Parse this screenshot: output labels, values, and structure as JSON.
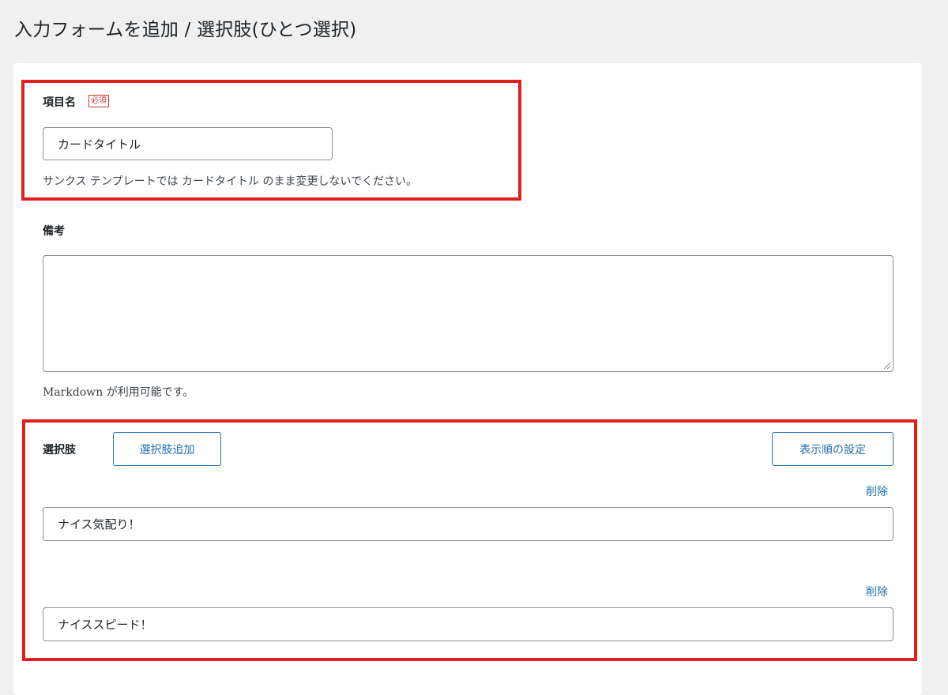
{
  "page": {
    "title": "入力フォームを追加 / 選択肢(ひとつ選択)"
  },
  "item_name": {
    "label": "項目名",
    "required_badge": "必須",
    "value": "カードタイトル",
    "help": "サンクス テンプレートでは カードタイトル のまま変更しないでください。"
  },
  "notes": {
    "label": "備考",
    "value": "",
    "help": "Markdown が利用可能です。"
  },
  "choices": {
    "label": "選択肢",
    "add_button": "選択肢追加",
    "order_button": "表示順の設定",
    "items": [
      {
        "delete_label": "削除",
        "value": "ナイス気配り！"
      },
      {
        "delete_label": "削除",
        "value": "ナイススピード！"
      }
    ]
  },
  "colors": {
    "highlight": "#e21f1f",
    "accent": "#2271b1",
    "required": "#d63638",
    "background": "#f0f0f1"
  },
  "icons": {
    "textarea_resize": "resize-handle-icon"
  }
}
